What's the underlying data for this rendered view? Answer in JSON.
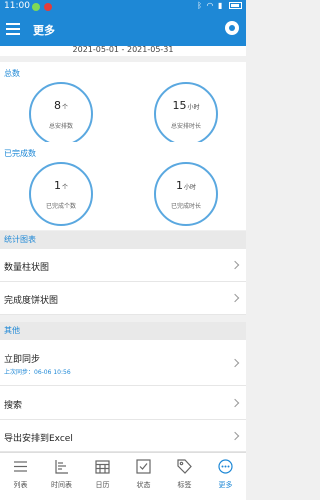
{
  "status_bar": {
    "time": "11:00"
  },
  "app_bar": {
    "title": "更多"
  },
  "date_range": "2021-05-01 - 2021-05-31",
  "totals": {
    "title": "总数",
    "items": [
      {
        "value": "8",
        "unit": "个",
        "label": "总安排数"
      },
      {
        "value": "15",
        "unit": "小时",
        "label": "总安排时长"
      }
    ]
  },
  "completed": {
    "title": "已完成数",
    "items": [
      {
        "value": "1",
        "unit": "个",
        "label": "已完成个数"
      },
      {
        "value": "1",
        "unit": "小时",
        "label": "已完成时长"
      }
    ]
  },
  "charts_group": {
    "title": "统计图表",
    "items": [
      {
        "label": "数量柱状图"
      },
      {
        "label": "完成度饼状图"
      }
    ]
  },
  "other_group": {
    "title": "其他",
    "sync": {
      "label": "立即同步",
      "sub": "上次同步：06-06 10:56"
    },
    "search": {
      "label": "搜索"
    },
    "export": {
      "label": "导出安排到Excel"
    }
  },
  "tabs": [
    {
      "label": "列表",
      "icon": "list-icon"
    },
    {
      "label": "时间表",
      "icon": "timeline-icon"
    },
    {
      "label": "日历",
      "icon": "calendar-icon"
    },
    {
      "label": "状态",
      "icon": "checkbox-icon"
    },
    {
      "label": "标签",
      "icon": "tag-icon"
    },
    {
      "label": "更多",
      "icon": "more-icon"
    }
  ],
  "colors": {
    "accent": "#1e88d6",
    "circle": "#5aa8e0",
    "background": "#f0f0f0"
  }
}
